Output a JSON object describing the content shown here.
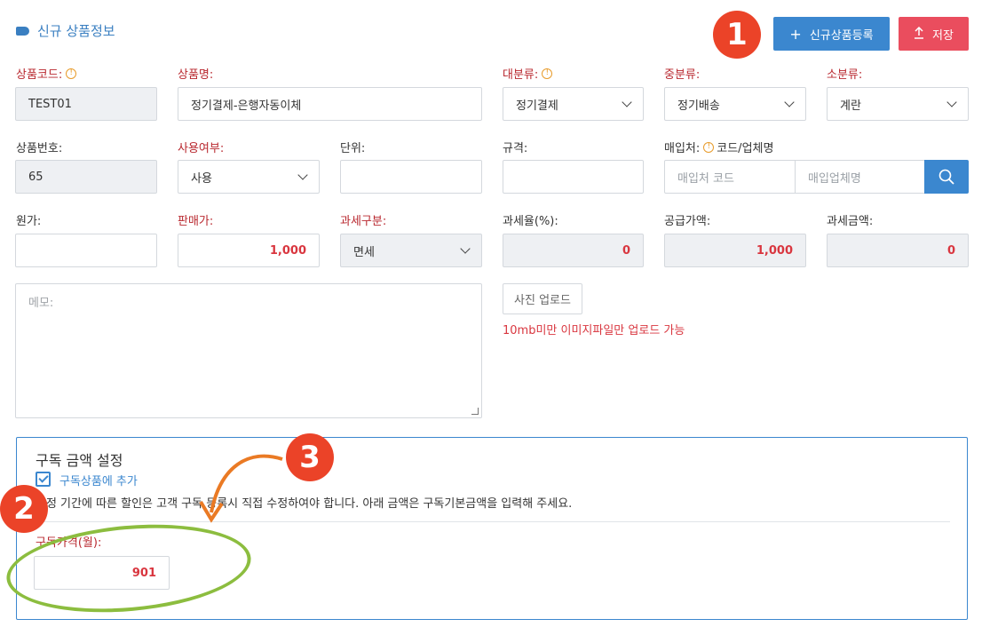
{
  "header": {
    "title": "신규 상품정보"
  },
  "toolbar": {
    "register_label": "신규상품등록",
    "save_label": "저장"
  },
  "fields": {
    "product_code": {
      "label": "상품코드:",
      "value": "TEST01"
    },
    "product_name": {
      "label": "상품명:",
      "value": "정기결제-은행자동이체"
    },
    "major_category": {
      "label": "대분류:",
      "value": "정기결제"
    },
    "middle_category": {
      "label": "중분류:",
      "value": "정기배송"
    },
    "minor_category": {
      "label": "소분류:",
      "value": "계란"
    },
    "product_number": {
      "label": "상품번호:",
      "value": "65"
    },
    "usage": {
      "label": "사용여부:",
      "value": "사용"
    },
    "unit": {
      "label": "단위:",
      "value": ""
    },
    "spec": {
      "label": "규격:",
      "value": ""
    },
    "supplier": {
      "label": "매입처:",
      "label_suffix": "코드/업체명",
      "code_placeholder": "매입처 코드",
      "name_placeholder": "매입업체명"
    },
    "cost": {
      "label": "원가:",
      "value": ""
    },
    "sale_price": {
      "label": "판매가:",
      "value": "1,000"
    },
    "tax_type": {
      "label": "과세구분:",
      "value": "면세"
    },
    "tax_rate": {
      "label": "과세율(%):",
      "value": "0"
    },
    "supply_price": {
      "label": "공급가액:",
      "value": "1,000"
    },
    "tax_amount": {
      "label": "과세금액:",
      "value": "0"
    },
    "memo": {
      "placeholder": "메모:"
    }
  },
  "upload": {
    "button_label": "사진 업로드",
    "note": "10mb미만 이미지파일만 업로드 가능"
  },
  "subscription": {
    "title": "구독 금액 설정",
    "checkbox_label": "구독상품에 추가",
    "checked": true,
    "note": "약정 기간에 따른 할인은 고객 구독 등록시 직접 수정하여야 합니다. 아래 금액은 구독기본금액을 입력해 주세요.",
    "price_label": "구독가격(월):",
    "price_value": "901"
  },
  "annotations": {
    "badge_1": "1",
    "badge_2": "2",
    "badge_3": "3"
  },
  "colors": {
    "accent": "#3b87cf",
    "danger": "#ea4d5e",
    "required": "#b9282f",
    "annotation": "#eb4328",
    "highlight_ring": "#8cbd3f"
  }
}
